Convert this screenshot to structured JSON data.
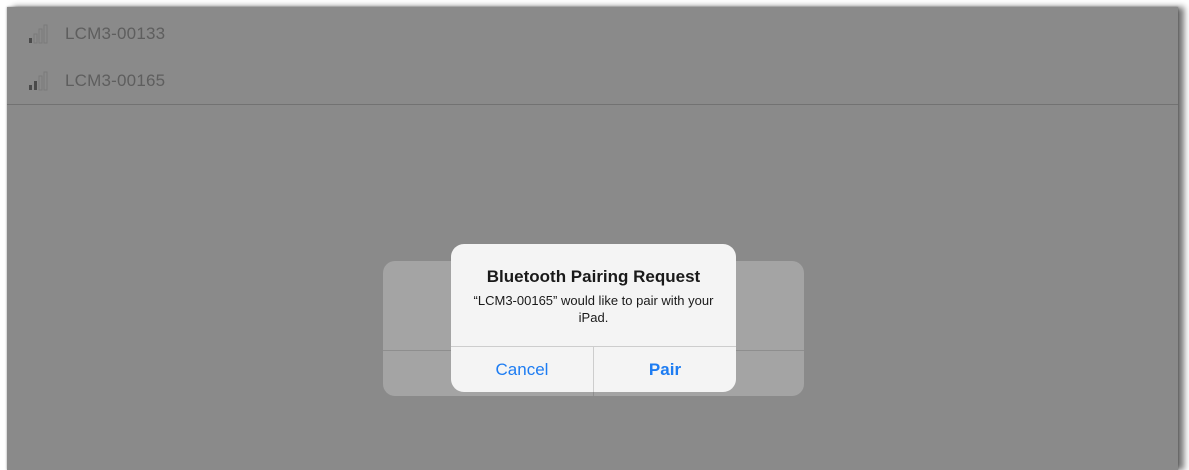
{
  "device_list": {
    "items": [
      {
        "name": "LCM3-00133",
        "signal_icon": "signal-strength-icon",
        "signal_bars": 1
      },
      {
        "name": "LCM3-00165",
        "signal_icon": "signal-strength-icon",
        "signal_bars": 2
      }
    ]
  },
  "alert": {
    "title": "Bluetooth Pairing Request",
    "message": "“LCM3-00165” would like to pair with your iPad.",
    "cancel_label": "Cancel",
    "pair_label": "Pair"
  },
  "colors": {
    "overlay": "#8a8a8a",
    "alert_background": "#f4f4f4",
    "button_text": "#1d7cf2",
    "device_text": "#5e5e5e"
  }
}
